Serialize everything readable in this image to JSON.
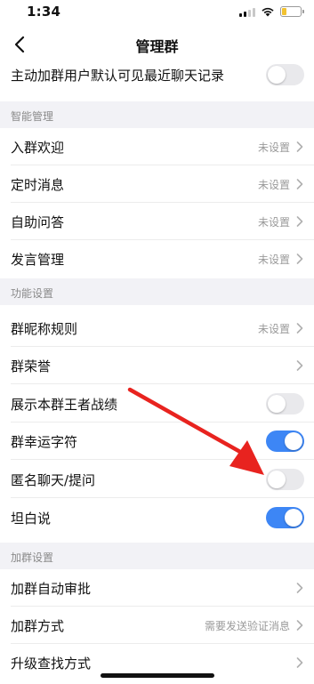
{
  "status_bar": {
    "time": "1:34",
    "battery_level": 0.25,
    "battery_color": "#f2c230"
  },
  "nav": {
    "title": "管理群"
  },
  "top_row": {
    "label": "主动加群用户默认可见最近聊天记录",
    "toggle_on": false
  },
  "sections": {
    "smart": {
      "title": "智能管理",
      "items": [
        {
          "label": "入群欢迎",
          "value": "未设置"
        },
        {
          "label": "定时消息",
          "value": "未设置"
        },
        {
          "label": "自助问答",
          "value": "未设置"
        },
        {
          "label": "发言管理",
          "value": "未设置"
        }
      ]
    },
    "features": {
      "title": "功能设置",
      "items": [
        {
          "label": "群昵称规则",
          "value": "未设置"
        },
        {
          "label": "群荣誉",
          "value": ""
        },
        {
          "label": "展示本群王者战绩",
          "toggle_on": false
        },
        {
          "label": "群幸运字符",
          "toggle_on": true
        },
        {
          "label": "匿名聊天/提问",
          "toggle_on": false
        },
        {
          "label": "坦白说",
          "toggle_on": true
        }
      ]
    },
    "join": {
      "title": "加群设置",
      "items": [
        {
          "label": "加群自动审批",
          "value": ""
        },
        {
          "label": "加群方式",
          "value": "需要发送验证消息"
        },
        {
          "label": "升级查找方式",
          "value": ""
        }
      ]
    }
  },
  "colors": {
    "toggle_on": "#3d86f5",
    "toggle_off": "#e9e9ec",
    "arrow": "#e8231f",
    "section_bg": "#f2f2f6"
  },
  "icons": {
    "back": "chevron-left-icon",
    "row_arrow": "chevron-right-icon",
    "annotation": "red-arrow-annotation"
  }
}
